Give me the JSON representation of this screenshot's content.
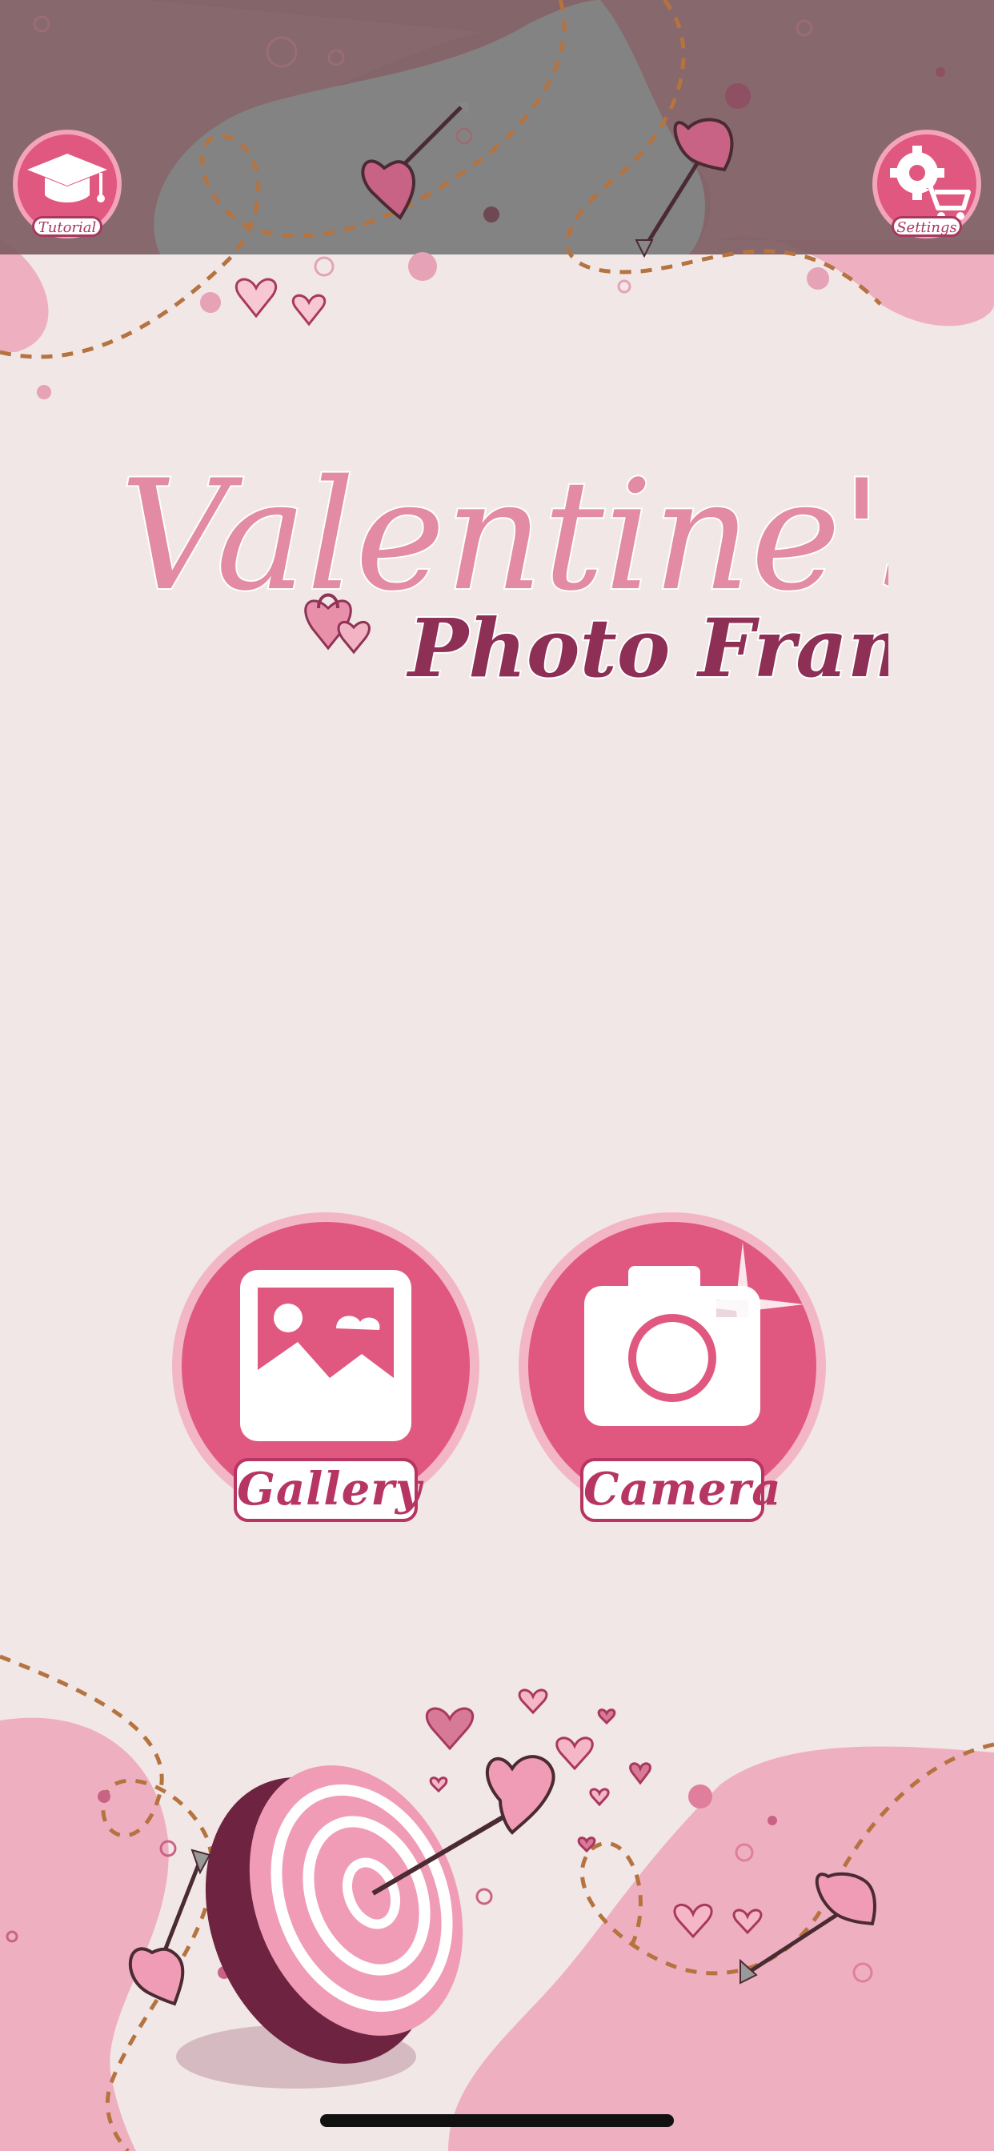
{
  "header": {
    "tutorial_label": "Tutorial",
    "settings_label": "Settings"
  },
  "title": {
    "line1": "Valentine's",
    "line2": "Photo Frames"
  },
  "actions": {
    "gallery_label": "Gallery",
    "camera_label": "Camera"
  },
  "colors": {
    "background": "#f1e7e7",
    "accent": "#e0577f",
    "accent_dark": "#b63563",
    "header_overlay": "#7e5d62",
    "deep_maroon": "#7a2747",
    "blob_pink": "#eeb0c0"
  },
  "icons": {
    "tutorial": "graduation-cap-icon",
    "settings": "gear-cart-icon",
    "gallery": "image-icon",
    "camera": "camera-icon"
  }
}
